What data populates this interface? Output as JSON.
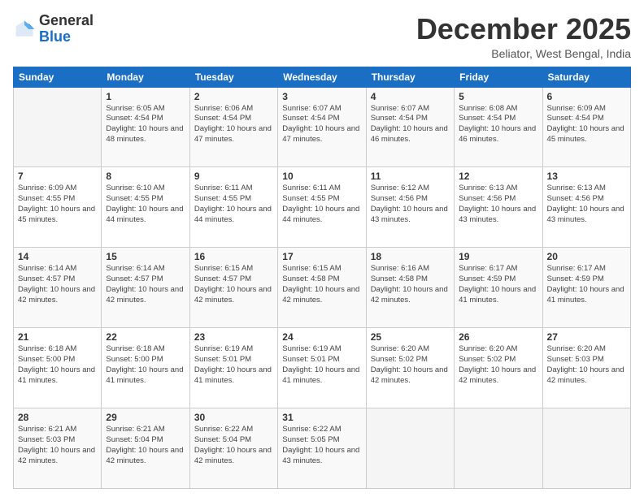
{
  "logo": {
    "general": "General",
    "blue": "Blue"
  },
  "header": {
    "month": "December 2025",
    "location": "Beliator, West Bengal, India"
  },
  "weekdays": [
    "Sunday",
    "Monday",
    "Tuesday",
    "Wednesday",
    "Thursday",
    "Friday",
    "Saturday"
  ],
  "weeks": [
    [
      {
        "day": "",
        "sunrise": "",
        "sunset": "",
        "daylight": ""
      },
      {
        "day": "1",
        "sunrise": "Sunrise: 6:05 AM",
        "sunset": "Sunset: 4:54 PM",
        "daylight": "Daylight: 10 hours and 48 minutes."
      },
      {
        "day": "2",
        "sunrise": "Sunrise: 6:06 AM",
        "sunset": "Sunset: 4:54 PM",
        "daylight": "Daylight: 10 hours and 47 minutes."
      },
      {
        "day": "3",
        "sunrise": "Sunrise: 6:07 AM",
        "sunset": "Sunset: 4:54 PM",
        "daylight": "Daylight: 10 hours and 47 minutes."
      },
      {
        "day": "4",
        "sunrise": "Sunrise: 6:07 AM",
        "sunset": "Sunset: 4:54 PM",
        "daylight": "Daylight: 10 hours and 46 minutes."
      },
      {
        "day": "5",
        "sunrise": "Sunrise: 6:08 AM",
        "sunset": "Sunset: 4:54 PM",
        "daylight": "Daylight: 10 hours and 46 minutes."
      },
      {
        "day": "6",
        "sunrise": "Sunrise: 6:09 AM",
        "sunset": "Sunset: 4:54 PM",
        "daylight": "Daylight: 10 hours and 45 minutes."
      }
    ],
    [
      {
        "day": "7",
        "sunrise": "Sunrise: 6:09 AM",
        "sunset": "Sunset: 4:55 PM",
        "daylight": "Daylight: 10 hours and 45 minutes."
      },
      {
        "day": "8",
        "sunrise": "Sunrise: 6:10 AM",
        "sunset": "Sunset: 4:55 PM",
        "daylight": "Daylight: 10 hours and 44 minutes."
      },
      {
        "day": "9",
        "sunrise": "Sunrise: 6:11 AM",
        "sunset": "Sunset: 4:55 PM",
        "daylight": "Daylight: 10 hours and 44 minutes."
      },
      {
        "day": "10",
        "sunrise": "Sunrise: 6:11 AM",
        "sunset": "Sunset: 4:55 PM",
        "daylight": "Daylight: 10 hours and 44 minutes."
      },
      {
        "day": "11",
        "sunrise": "Sunrise: 6:12 AM",
        "sunset": "Sunset: 4:56 PM",
        "daylight": "Daylight: 10 hours and 43 minutes."
      },
      {
        "day": "12",
        "sunrise": "Sunrise: 6:13 AM",
        "sunset": "Sunset: 4:56 PM",
        "daylight": "Daylight: 10 hours and 43 minutes."
      },
      {
        "day": "13",
        "sunrise": "Sunrise: 6:13 AM",
        "sunset": "Sunset: 4:56 PM",
        "daylight": "Daylight: 10 hours and 43 minutes."
      }
    ],
    [
      {
        "day": "14",
        "sunrise": "Sunrise: 6:14 AM",
        "sunset": "Sunset: 4:57 PM",
        "daylight": "Daylight: 10 hours and 42 minutes."
      },
      {
        "day": "15",
        "sunrise": "Sunrise: 6:14 AM",
        "sunset": "Sunset: 4:57 PM",
        "daylight": "Daylight: 10 hours and 42 minutes."
      },
      {
        "day": "16",
        "sunrise": "Sunrise: 6:15 AM",
        "sunset": "Sunset: 4:57 PM",
        "daylight": "Daylight: 10 hours and 42 minutes."
      },
      {
        "day": "17",
        "sunrise": "Sunrise: 6:15 AM",
        "sunset": "Sunset: 4:58 PM",
        "daylight": "Daylight: 10 hours and 42 minutes."
      },
      {
        "day": "18",
        "sunrise": "Sunrise: 6:16 AM",
        "sunset": "Sunset: 4:58 PM",
        "daylight": "Daylight: 10 hours and 42 minutes."
      },
      {
        "day": "19",
        "sunrise": "Sunrise: 6:17 AM",
        "sunset": "Sunset: 4:59 PM",
        "daylight": "Daylight: 10 hours and 41 minutes."
      },
      {
        "day": "20",
        "sunrise": "Sunrise: 6:17 AM",
        "sunset": "Sunset: 4:59 PM",
        "daylight": "Daylight: 10 hours and 41 minutes."
      }
    ],
    [
      {
        "day": "21",
        "sunrise": "Sunrise: 6:18 AM",
        "sunset": "Sunset: 5:00 PM",
        "daylight": "Daylight: 10 hours and 41 minutes."
      },
      {
        "day": "22",
        "sunrise": "Sunrise: 6:18 AM",
        "sunset": "Sunset: 5:00 PM",
        "daylight": "Daylight: 10 hours and 41 minutes."
      },
      {
        "day": "23",
        "sunrise": "Sunrise: 6:19 AM",
        "sunset": "Sunset: 5:01 PM",
        "daylight": "Daylight: 10 hours and 41 minutes."
      },
      {
        "day": "24",
        "sunrise": "Sunrise: 6:19 AM",
        "sunset": "Sunset: 5:01 PM",
        "daylight": "Daylight: 10 hours and 41 minutes."
      },
      {
        "day": "25",
        "sunrise": "Sunrise: 6:20 AM",
        "sunset": "Sunset: 5:02 PM",
        "daylight": "Daylight: 10 hours and 42 minutes."
      },
      {
        "day": "26",
        "sunrise": "Sunrise: 6:20 AM",
        "sunset": "Sunset: 5:02 PM",
        "daylight": "Daylight: 10 hours and 42 minutes."
      },
      {
        "day": "27",
        "sunrise": "Sunrise: 6:20 AM",
        "sunset": "Sunset: 5:03 PM",
        "daylight": "Daylight: 10 hours and 42 minutes."
      }
    ],
    [
      {
        "day": "28",
        "sunrise": "Sunrise: 6:21 AM",
        "sunset": "Sunset: 5:03 PM",
        "daylight": "Daylight: 10 hours and 42 minutes."
      },
      {
        "day": "29",
        "sunrise": "Sunrise: 6:21 AM",
        "sunset": "Sunset: 5:04 PM",
        "daylight": "Daylight: 10 hours and 42 minutes."
      },
      {
        "day": "30",
        "sunrise": "Sunrise: 6:22 AM",
        "sunset": "Sunset: 5:04 PM",
        "daylight": "Daylight: 10 hours and 42 minutes."
      },
      {
        "day": "31",
        "sunrise": "Sunrise: 6:22 AM",
        "sunset": "Sunset: 5:05 PM",
        "daylight": "Daylight: 10 hours and 43 minutes."
      },
      {
        "day": "",
        "sunrise": "",
        "sunset": "",
        "daylight": ""
      },
      {
        "day": "",
        "sunrise": "",
        "sunset": "",
        "daylight": ""
      },
      {
        "day": "",
        "sunrise": "",
        "sunset": "",
        "daylight": ""
      }
    ]
  ]
}
